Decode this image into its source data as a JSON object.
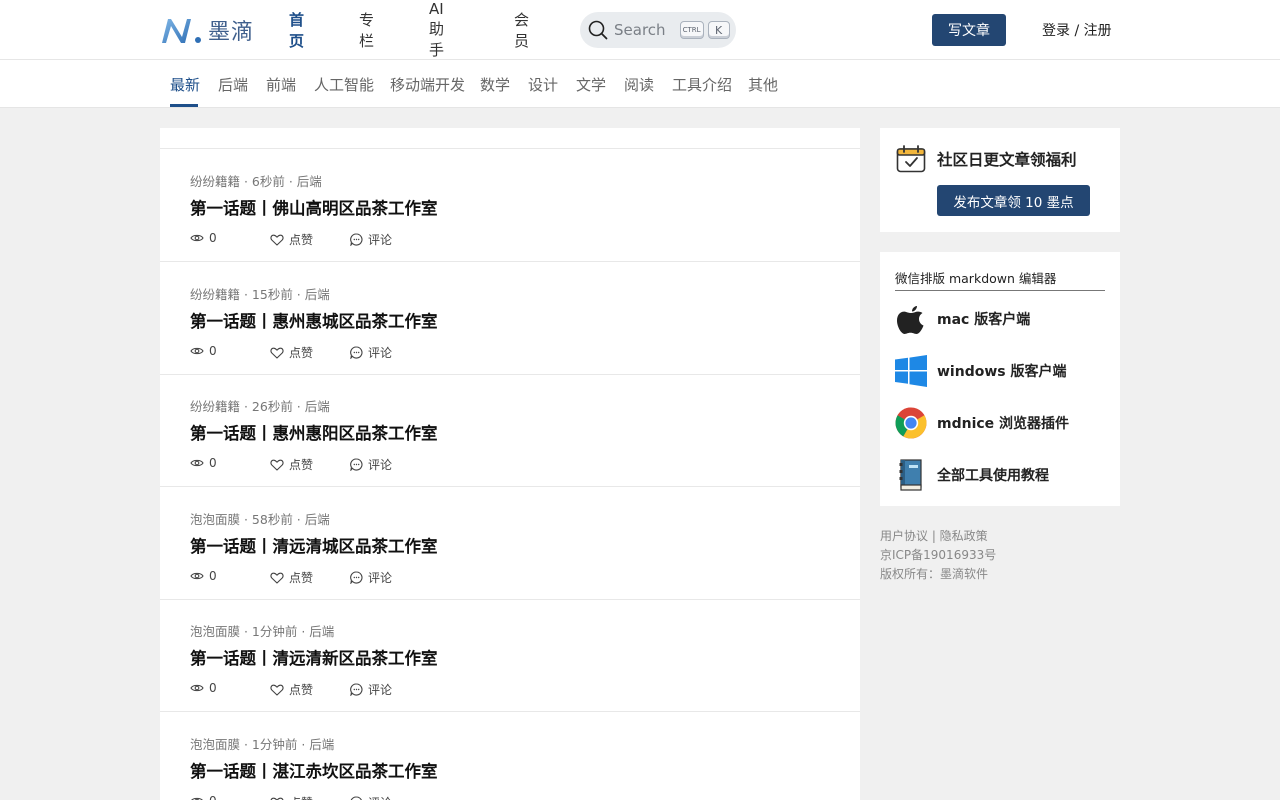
{
  "header": {
    "logo_text": "墨滴",
    "nav": [
      "首页",
      "专栏",
      "AI助手",
      "会员"
    ],
    "search": {
      "placeholder": "Search",
      "kbd_ctrl": "CTRL",
      "kbd_k": "K"
    },
    "write_label": "写文章",
    "login_label": "登录 / 注册"
  },
  "categories": [
    "最新",
    "后端",
    "前端",
    "人工智能",
    "移动端开发",
    "数学",
    "设计",
    "文学",
    "阅读",
    "工具介绍",
    "其他"
  ],
  "actions": {
    "like_label": "点赞",
    "comment_label": "评论"
  },
  "posts": [
    {
      "meta": "纷纷籍籍 · 6秒前 · 后端",
      "title": "第一话题丨佛山高明区品茶工作室",
      "views": "0"
    },
    {
      "meta": "纷纷籍籍 · 15秒前 · 后端",
      "title": "第一话题丨惠州惠城区品茶工作室",
      "views": "0"
    },
    {
      "meta": "纷纷籍籍 · 26秒前 · 后端",
      "title": "第一话题丨惠州惠阳区品茶工作室",
      "views": "0"
    },
    {
      "meta": "泡泡面膜 · 58秒前 · 后端",
      "title": "第一话题丨清远清城区品茶工作室",
      "views": "0"
    },
    {
      "meta": "泡泡面膜 · 1分钟前 · 后端",
      "title": "第一话题丨清远清新区品茶工作室",
      "views": "0"
    },
    {
      "meta": "泡泡面膜 · 1分钟前 · 后端",
      "title": "第一话题丨湛江赤坎区品茶工作室",
      "views": "0"
    }
  ],
  "sidebar": {
    "promo_title": "社区日更文章领福利",
    "promo_button": "发布文章领 10 墨点",
    "tools_heading": "微信排版 markdown 编辑器",
    "tools": [
      {
        "label": "mac 版客户端",
        "icon": "apple-icon"
      },
      {
        "label": "windows 版客户端",
        "icon": "windows-icon"
      },
      {
        "label": "mdnice 浏览器插件",
        "icon": "chrome-icon"
      },
      {
        "label": "全部工具使用教程",
        "icon": "book-icon"
      }
    ]
  },
  "footer": {
    "links": "用户协议 | 隐私政策",
    "icp": "京ICP备19016933号",
    "copyright": "版权所有：墨滴软件"
  },
  "colors": {
    "brand": "#234672",
    "active": "#1e4f8a",
    "background": "#f0f0f0"
  }
}
